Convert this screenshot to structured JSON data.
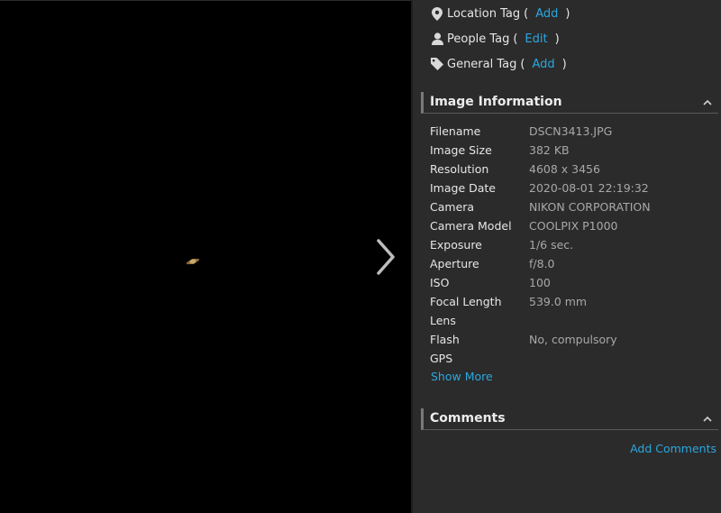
{
  "tags": [
    {
      "icon": "location-pin-icon",
      "label": "Location Tag",
      "action": "Add"
    },
    {
      "icon": "person-icon",
      "label": "People Tag",
      "action": "Edit"
    },
    {
      "icon": "tag-icon",
      "label": "General Tag",
      "action": "Add"
    }
  ],
  "paren_open": "(",
  "paren_close": ")",
  "image_info": {
    "title": "Image Information",
    "rows": [
      {
        "key": "Filename",
        "value": "DSCN3413.JPG"
      },
      {
        "key": "Image Size",
        "value": "382 KB"
      },
      {
        "key": "Resolution",
        "value": "4608 x 3456"
      },
      {
        "key": "Image Date",
        "value": "2020-08-01 22:19:32"
      },
      {
        "key": "Camera",
        "value": "NIKON CORPORATION"
      },
      {
        "key": "Camera Model",
        "value": "COOLPIX P1000"
      },
      {
        "key": "Exposure",
        "value": "1/6 sec."
      },
      {
        "key": "Aperture",
        "value": "f/8.0"
      },
      {
        "key": "ISO",
        "value": "100"
      },
      {
        "key": "Focal Length",
        "value": "539.0 mm"
      },
      {
        "key": "Lens",
        "value": ""
      },
      {
        "key": "Flash",
        "value": "No, compulsory"
      },
      {
        "key": "GPS",
        "value": ""
      }
    ],
    "show_more": "Show More"
  },
  "comments": {
    "title": "Comments",
    "add_label": "Add Comments"
  },
  "colors": {
    "link": "#2aa7e0",
    "background": "#2b2b2b",
    "viewer": "#000000"
  }
}
